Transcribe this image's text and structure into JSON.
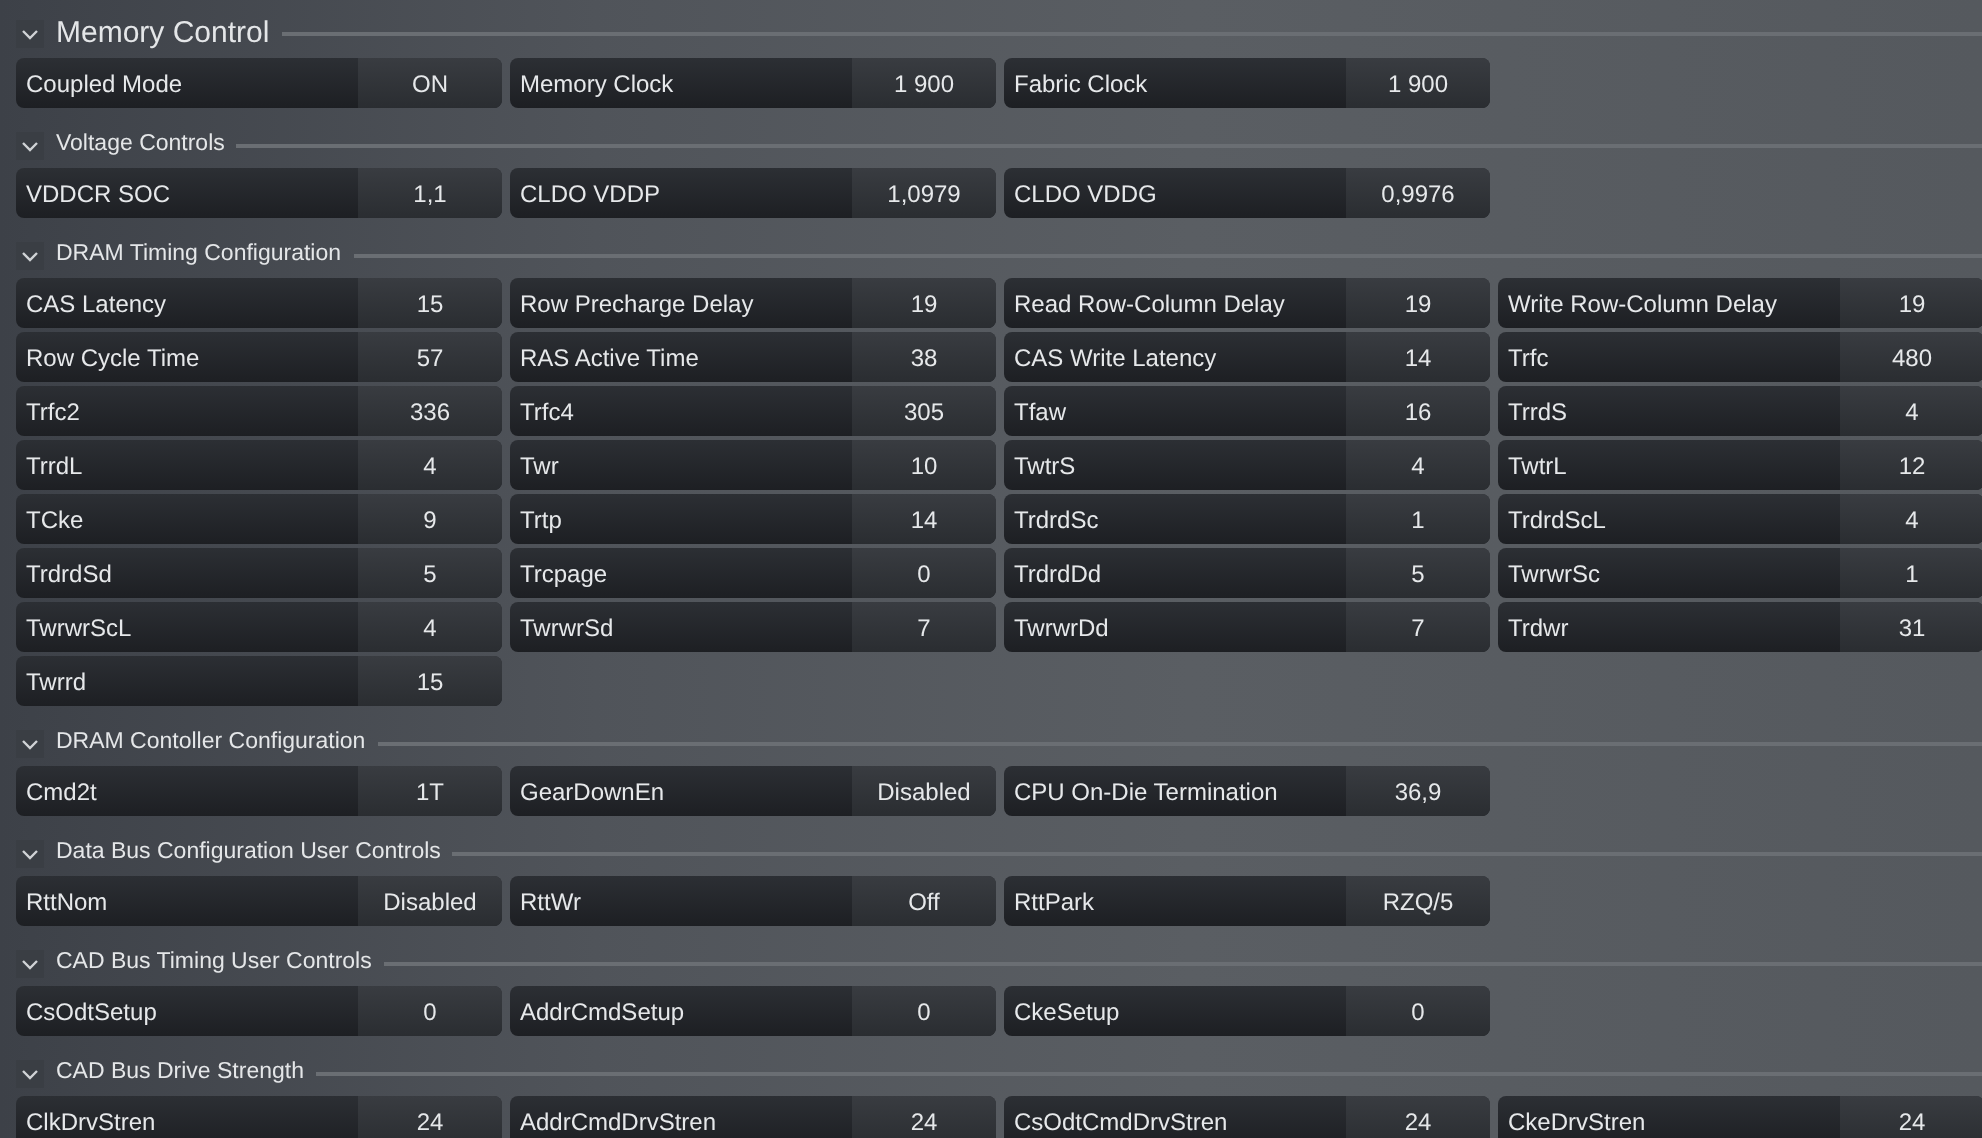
{
  "sections": [
    {
      "kind": "main",
      "title": "Memory Control",
      "expanded": true,
      "items": [
        {
          "label": "Coupled Mode",
          "value": "ON"
        },
        {
          "label": "Memory Clock",
          "value": "1 900"
        },
        {
          "label": "Fabric Clock",
          "value": "1 900"
        }
      ]
    },
    {
      "kind": "sub",
      "title": "Voltage Controls",
      "expanded": true,
      "items": [
        {
          "label": "VDDCR SOC",
          "value": "1,1"
        },
        {
          "label": "CLDO VDDP",
          "value": "1,0979"
        },
        {
          "label": "CLDO VDDG",
          "value": "0,9976"
        }
      ]
    },
    {
      "kind": "sub",
      "title": "DRAM Timing Configuration",
      "expanded": true,
      "items": [
        {
          "label": "CAS Latency",
          "value": "15"
        },
        {
          "label": "Row Precharge Delay",
          "value": "19"
        },
        {
          "label": "Read Row-Column Delay",
          "value": "19"
        },
        {
          "label": "Write Row-Column Delay",
          "value": "19"
        },
        {
          "label": "Row Cycle Time",
          "value": "57"
        },
        {
          "label": "RAS Active Time",
          "value": "38"
        },
        {
          "label": "CAS Write Latency",
          "value": "14"
        },
        {
          "label": "Trfc",
          "value": "480"
        },
        {
          "label": "Trfc2",
          "value": "336"
        },
        {
          "label": "Trfc4",
          "value": "305"
        },
        {
          "label": "Tfaw",
          "value": "16"
        },
        {
          "label": "TrrdS",
          "value": "4"
        },
        {
          "label": "TrrdL",
          "value": "4"
        },
        {
          "label": "Twr",
          "value": "10"
        },
        {
          "label": "TwtrS",
          "value": "4"
        },
        {
          "label": "TwtrL",
          "value": "12"
        },
        {
          "label": "TCke",
          "value": "9"
        },
        {
          "label": "Trtp",
          "value": "14"
        },
        {
          "label": "TrdrdSc",
          "value": "1"
        },
        {
          "label": "TrdrdScL",
          "value": "4"
        },
        {
          "label": "TrdrdSd",
          "value": "5"
        },
        {
          "label": "Trcpage",
          "value": "0"
        },
        {
          "label": "TrdrdDd",
          "value": "5"
        },
        {
          "label": "TwrwrSc",
          "value": "1"
        },
        {
          "label": "TwrwrScL",
          "value": "4"
        },
        {
          "label": "TwrwrSd",
          "value": "7"
        },
        {
          "label": "TwrwrDd",
          "value": "7"
        },
        {
          "label": "Trdwr",
          "value": "31"
        },
        {
          "label": "Twrrd",
          "value": "15"
        }
      ]
    },
    {
      "kind": "sub",
      "title": "DRAM Contoller Configuration",
      "expanded": true,
      "items": [
        {
          "label": "Cmd2t",
          "value": "1T"
        },
        {
          "label": "GearDownEn",
          "value": "Disabled"
        },
        {
          "label": "CPU On-Die Termination",
          "value": "36,9"
        }
      ]
    },
    {
      "kind": "sub",
      "title": "Data Bus Configuration User Controls",
      "expanded": true,
      "items": [
        {
          "label": "RttNom",
          "value": "Disabled"
        },
        {
          "label": "RttWr",
          "value": "Off"
        },
        {
          "label": "RttPark",
          "value": "RZQ/5"
        }
      ]
    },
    {
      "kind": "sub",
      "title": "CAD Bus Timing User Controls",
      "expanded": true,
      "items": [
        {
          "label": "CsOdtSetup",
          "value": "0"
        },
        {
          "label": "AddrCmdSetup",
          "value": "0"
        },
        {
          "label": "CkeSetup",
          "value": "0"
        }
      ]
    },
    {
      "kind": "sub",
      "title": "CAD Bus Drive Strength",
      "expanded": true,
      "items": [
        {
          "label": "ClkDrvStren",
          "value": "24"
        },
        {
          "label": "AddrCmdDrvStren",
          "value": "24"
        },
        {
          "label": "CsOdtCmdDrvStren",
          "value": "24"
        },
        {
          "label": "CkeDrvStren",
          "value": "24"
        }
      ]
    }
  ]
}
